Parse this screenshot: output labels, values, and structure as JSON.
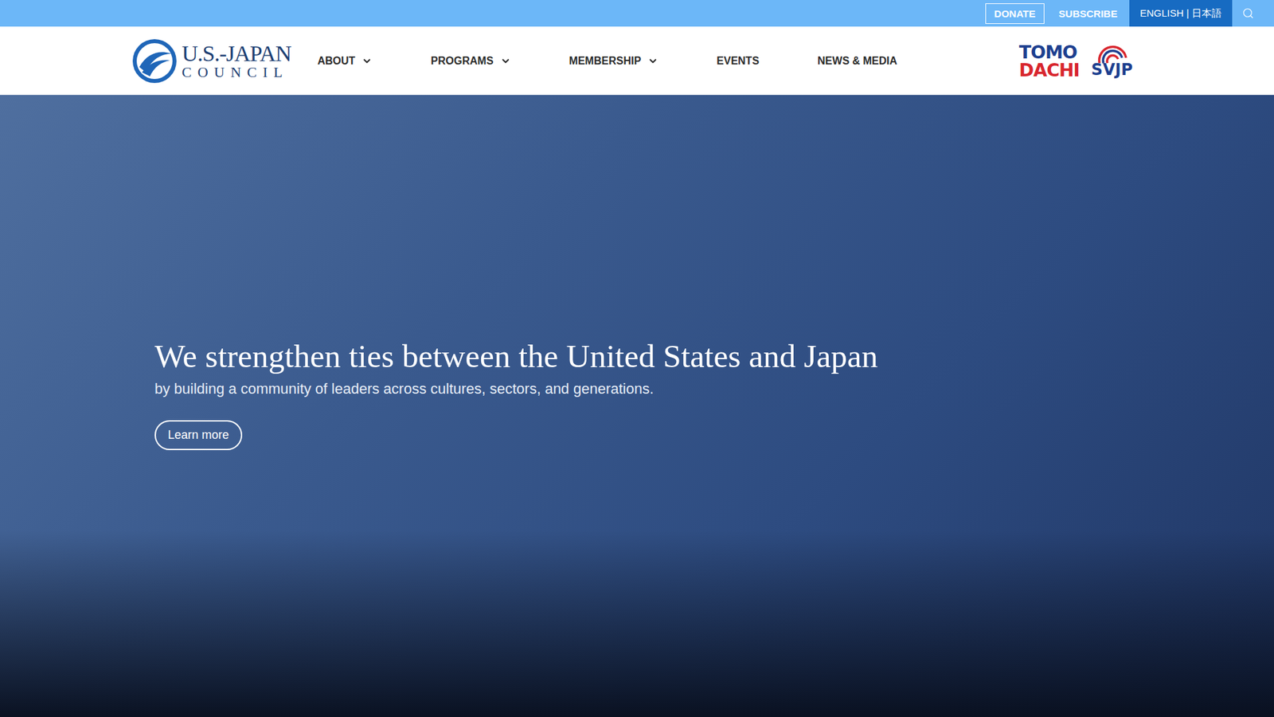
{
  "top_bar": {
    "donate": "DONATE",
    "subscribe": "SUBSCRIBE",
    "language": "ENGLISH | 日本語"
  },
  "logo": {
    "line1": "U.S.-JAPAN",
    "line2": "COUNCIL"
  },
  "nav": {
    "items": [
      {
        "label": "ABOUT",
        "dropdown": true
      },
      {
        "label": "PROGRAMS",
        "dropdown": true
      },
      {
        "label": "MEMBERSHIP",
        "dropdown": true
      },
      {
        "label": "EVENTS",
        "dropdown": false
      },
      {
        "label": "NEWS & MEDIA",
        "dropdown": false
      }
    ]
  },
  "partner_logos": {
    "tomodachi": [
      "TOMO",
      "DACHI"
    ],
    "svjp": "SVJP"
  },
  "hero": {
    "headline": "We strengthen ties between the United States and Japan",
    "subheading": "by building a community of leaders across cultures, sectors, and generations.",
    "button": "Learn more"
  }
}
